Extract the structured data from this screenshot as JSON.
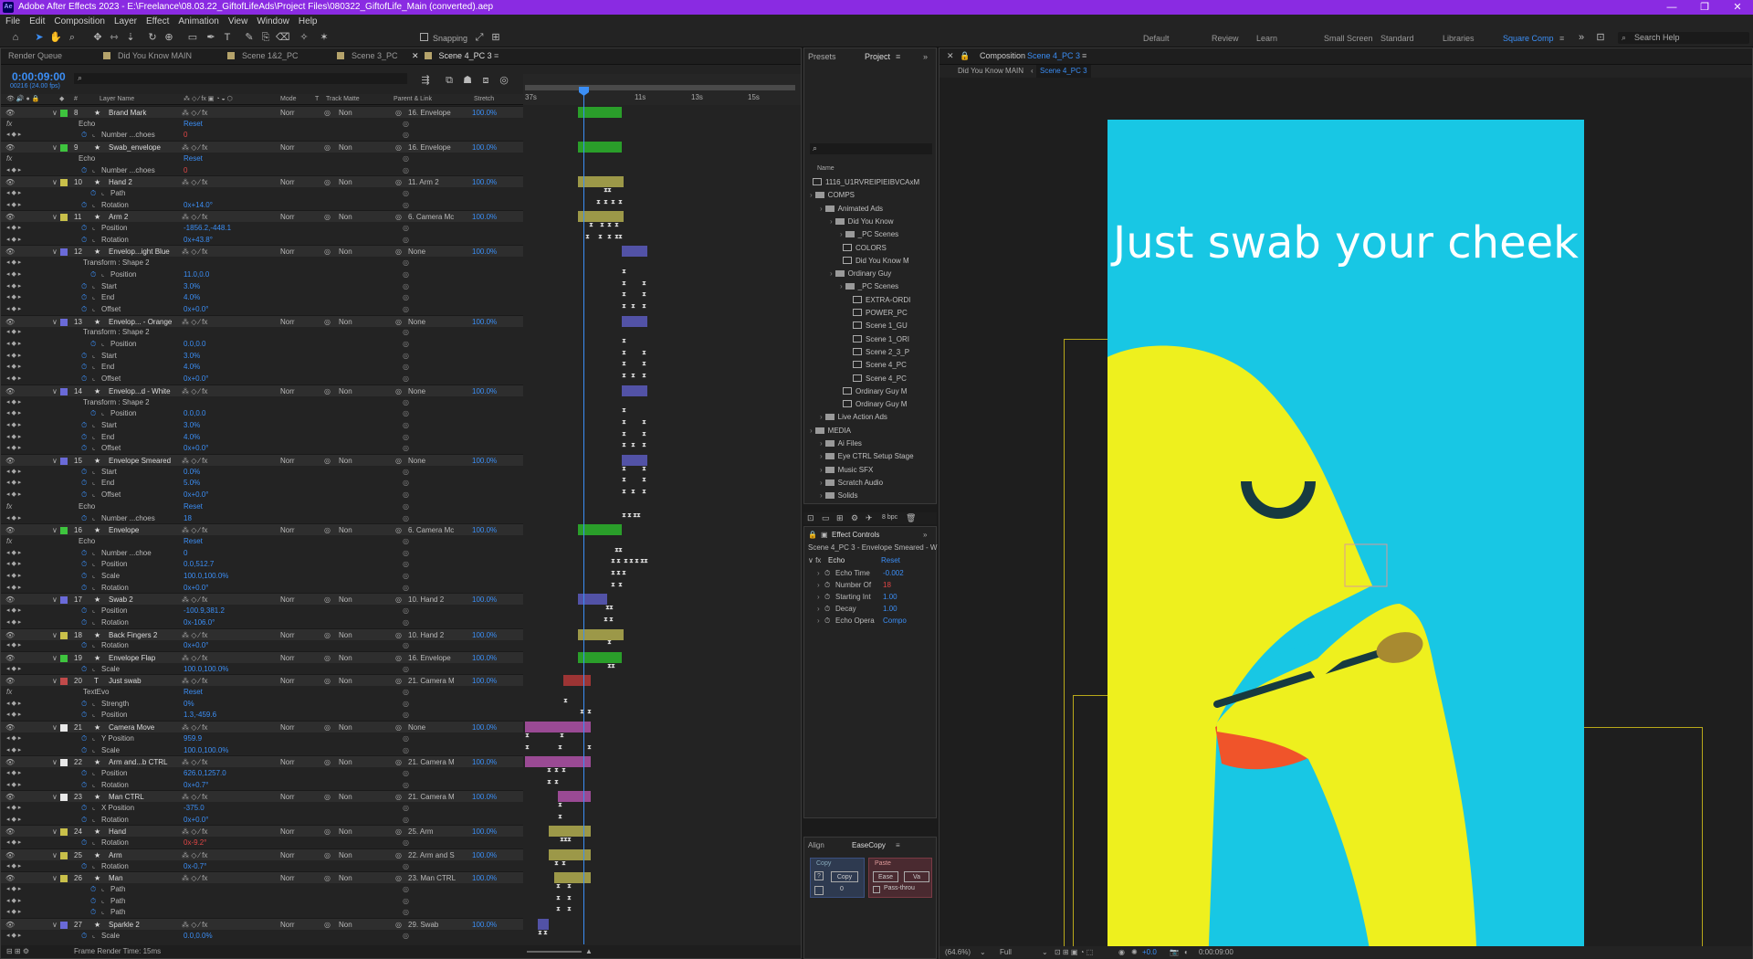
{
  "titlebar": {
    "app_logo": "Ae",
    "title": "Adobe After Effects 2023 - E:\\Freelance\\08.03.22_GiftofLifeAds\\Project Files\\080322_GiftofLife_Main (converted).aep",
    "minimize": "—",
    "maximize": "❐",
    "close": "✕"
  },
  "menu": [
    "File",
    "Edit",
    "Composition",
    "Layer",
    "Effect",
    "Animation",
    "View",
    "Window",
    "Help"
  ],
  "toolbar": {
    "snapping": "Snapping",
    "workspaces": [
      "Default",
      "Review",
      "Learn",
      "Small Screen",
      "Standard",
      "Libraries",
      "Square Comp"
    ],
    "active_workspace": "Square Comp",
    "search_help": "Search Help"
  },
  "timeline": {
    "tabs": [
      "Render Queue",
      "Did You Know MAIN",
      "Scene 1&2_PC",
      "Scene 3_PC",
      "Scene 4_PC 3"
    ],
    "timecode": "0:00:09:00",
    "fps": "00216 (24.00 fps)",
    "columns": [
      "Layer Name",
      "Mode",
      "T",
      "Track Matte",
      "Parent & Link",
      "Stretch"
    ],
    "ruler": [
      "37s",
      "11s",
      "13s",
      "15s"
    ],
    "footer": "Frame Render Time: 15ms",
    "rows": [
      {
        "t": "L",
        "n": "8",
        "name": "Brand Mark",
        "mode": "Norr",
        "mat": "Non",
        "parent": "16. Envelope",
        "str": "100.0%",
        "c": "#3ec43e",
        "bar": [
          60,
          108
        ],
        "bc": "#2a9e2a"
      },
      {
        "t": "P",
        "ind": 85,
        "name": "Echo",
        "val": "Reset"
      },
      {
        "t": "P",
        "ind": 110,
        "name": "Number ...choes",
        "val": "0",
        "red": true
      },
      {
        "t": "L",
        "n": "9",
        "name": "Swab_envelope",
        "mode": "Norr",
        "mat": "Non",
        "parent": "16. Envelope",
        "str": "100.0%",
        "c": "#3ec43e",
        "bar": [
          60,
          108
        ],
        "bc": "#2a9e2a"
      },
      {
        "t": "P",
        "ind": 85,
        "name": "Echo",
        "val": "Reset"
      },
      {
        "t": "P",
        "ind": 110,
        "name": "Number ...choes",
        "val": "0",
        "red": true
      },
      {
        "t": "L",
        "n": "10",
        "name": "Hand 2",
        "mode": "Norr",
        "mat": "Non",
        "parent": "11. Arm 2",
        "str": "100.0%",
        "c": "#c9c04a",
        "bar": [
          60,
          110
        ],
        "bc": "#9c9848"
      },
      {
        "t": "P",
        "ind": 120,
        "name": "Path",
        "val": "",
        "kf": [
          88,
          92
        ]
      },
      {
        "t": "P",
        "ind": 110,
        "name": "Rotation",
        "val": "0x+14.0°",
        "kf": [
          80,
          88,
          96,
          104
        ]
      },
      {
        "t": "L",
        "n": "11",
        "name": "Arm 2",
        "mode": "Norr",
        "mat": "Non",
        "parent": "6. Camera Mc",
        "str": "100.0%",
        "c": "#c9c04a",
        "bar": [
          60,
          110
        ],
        "bc": "#9c9848"
      },
      {
        "t": "P",
        "ind": 110,
        "name": "Position",
        "val": "-1856.2,-448.1",
        "kf": [
          72,
          84,
          92,
          100
        ]
      },
      {
        "t": "P",
        "ind": 110,
        "name": "Rotation",
        "val": "0x+43.8°",
        "kf": [
          68,
          82,
          92,
          100,
          104
        ]
      },
      {
        "t": "L",
        "n": "12",
        "name": "Envelop...ight Blue",
        "mode": "Norr",
        "mat": "Non",
        "parent": "None",
        "str": "100.0%",
        "c": "#6a6ad8",
        "bar": [
          108,
          136
        ],
        "bc": "#5252a6"
      },
      {
        "t": "P",
        "ind": 90,
        "name": "Transform : Shape 2",
        "val": ""
      },
      {
        "t": "P",
        "ind": 120,
        "name": "Position",
        "val": "11.0,0.0",
        "kf": [
          108
        ]
      },
      {
        "t": "P",
        "ind": 110,
        "name": "Start",
        "val": "3.0%",
        "kf": [
          108,
          130
        ]
      },
      {
        "t": "P",
        "ind": 110,
        "name": "End",
        "val": "4.0%",
        "kf": [
          108,
          130
        ]
      },
      {
        "t": "P",
        "ind": 110,
        "name": "Offset",
        "val": "0x+0.0°",
        "kf": [
          108,
          118,
          130
        ]
      },
      {
        "t": "L",
        "n": "13",
        "name": "Envelop... - Orange",
        "mode": "Norr",
        "mat": "Non",
        "parent": "None",
        "str": "100.0%",
        "c": "#6a6ad8",
        "bar": [
          108,
          136
        ],
        "bc": "#5252a6"
      },
      {
        "t": "P",
        "ind": 90,
        "name": "Transform : Shape 2",
        "val": ""
      },
      {
        "t": "P",
        "ind": 120,
        "name": "Position",
        "val": "0.0,0.0",
        "kf": [
          108
        ]
      },
      {
        "t": "P",
        "ind": 110,
        "name": "Start",
        "val": "3.0%",
        "kf": [
          108,
          130
        ]
      },
      {
        "t": "P",
        "ind": 110,
        "name": "End",
        "val": "4.0%",
        "kf": [
          108,
          130
        ]
      },
      {
        "t": "P",
        "ind": 110,
        "name": "Offset",
        "val": "0x+0.0°",
        "kf": [
          108,
          118,
          130
        ]
      },
      {
        "t": "L",
        "n": "14",
        "name": "Envelop...d - White",
        "mode": "Norr",
        "mat": "Non",
        "parent": "None",
        "str": "100.0%",
        "c": "#6a6ad8",
        "bar": [
          108,
          136
        ],
        "bc": "#5252a6"
      },
      {
        "t": "P",
        "ind": 90,
        "name": "Transform : Shape 2",
        "val": ""
      },
      {
        "t": "P",
        "ind": 120,
        "name": "Position",
        "val": "0.0,0.0",
        "kf": [
          108
        ]
      },
      {
        "t": "P",
        "ind": 110,
        "name": "Start",
        "val": "3.0%",
        "kf": [
          108,
          130
        ]
      },
      {
        "t": "P",
        "ind": 110,
        "name": "End",
        "val": "4.0%",
        "kf": [
          108,
          130
        ]
      },
      {
        "t": "P",
        "ind": 110,
        "name": "Offset",
        "val": "0x+0.0°",
        "kf": [
          108,
          118,
          130
        ]
      },
      {
        "t": "L",
        "n": "15",
        "name": "Envelope Smeared",
        "mode": "Norr",
        "mat": "Non",
        "parent": "None",
        "str": "100.0%",
        "c": "#6a6ad8",
        "bar": [
          108,
          136
        ],
        "bc": "#5252a6"
      },
      {
        "t": "P",
        "ind": 110,
        "name": "Start",
        "val": "0.0%",
        "kf": [
          108,
          130
        ]
      },
      {
        "t": "P",
        "ind": 110,
        "name": "End",
        "val": "5.0%",
        "kf": [
          108,
          130
        ]
      },
      {
        "t": "P",
        "ind": 110,
        "name": "Offset",
        "val": "0x+0.0°",
        "kf": [
          108,
          118,
          130
        ]
      },
      {
        "t": "P",
        "ind": 85,
        "name": "Echo",
        "val": "Reset"
      },
      {
        "t": "P",
        "ind": 110,
        "name": "Number ...choes",
        "val": "18",
        "kf": [
          108,
          114,
          120,
          124
        ]
      },
      {
        "t": "L",
        "n": "16",
        "name": "Envelope",
        "mode": "Norr",
        "mat": "Non",
        "parent": "6. Camera Mc",
        "str": "100.0%",
        "c": "#3ec43e",
        "bar": [
          60,
          108
        ],
        "bc": "#2a9e2a"
      },
      {
        "t": "P",
        "ind": 85,
        "name": "Echo",
        "val": "Reset"
      },
      {
        "t": "P",
        "ind": 110,
        "name": "Number ...choe",
        "val": "0",
        "kf": [
          100,
          104
        ]
      },
      {
        "t": "P",
        "ind": 110,
        "name": "Position",
        "val": "0.0,512.7",
        "kf": [
          96,
          102,
          110,
          116,
          122,
          128,
          132
        ]
      },
      {
        "t": "P",
        "ind": 110,
        "name": "Scale",
        "val": "100.0,100.0%",
        "kf": [
          96,
          102,
          108
        ]
      },
      {
        "t": "P",
        "ind": 110,
        "name": "Rotation",
        "val": "0x+0.0°",
        "kf": [
          96,
          104
        ]
      },
      {
        "t": "L",
        "n": "17",
        "name": "Swab 2",
        "mode": "Norr",
        "mat": "Non",
        "parent": "10. Hand 2",
        "str": "100.0%",
        "c": "#6a6ad8",
        "bar": [
          60,
          92
        ],
        "bc": "#5252a6"
      },
      {
        "t": "P",
        "ind": 110,
        "name": "Position",
        "val": "-100.9,381.2",
        "kf": [
          90,
          94
        ]
      },
      {
        "t": "P",
        "ind": 110,
        "name": "Rotation",
        "val": "0x-106.0°",
        "kf": [
          88,
          94
        ]
      },
      {
        "t": "L",
        "n": "18",
        "name": "Back Fingers 2",
        "mode": "Norr",
        "mat": "Non",
        "parent": "10. Hand 2",
        "str": "100.0%",
        "c": "#c9c04a",
        "bar": [
          60,
          110
        ],
        "bc": "#9c9848"
      },
      {
        "t": "P",
        "ind": 110,
        "name": "Rotation",
        "val": "0x+0.0°",
        "kf": [
          92
        ]
      },
      {
        "t": "L",
        "n": "19",
        "name": "Envelope Flap",
        "mode": "Norr",
        "mat": "Non",
        "parent": "16. Envelope",
        "str": "100.0%",
        "c": "#3ec43e",
        "bar": [
          60,
          108
        ],
        "bc": "#2a9e2a"
      },
      {
        "t": "P",
        "ind": 110,
        "name": "Scale",
        "val": "100.0,100.0%",
        "kf": [
          92,
          96
        ]
      },
      {
        "t": "L",
        "n": "20",
        "name": "Just swab",
        "mode": "Norr",
        "mat": "Non",
        "parent": "21. Camera M",
        "str": "100.0%",
        "c": "#c14a4a",
        "bar": [
          44,
          74
        ],
        "bc": "#9c3434",
        "text": true
      },
      {
        "t": "P",
        "ind": 90,
        "name": "TextEvo",
        "val": "Reset"
      },
      {
        "t": "P",
        "ind": 110,
        "name": "Strength",
        "val": "0%",
        "kf": [
          44
        ]
      },
      {
        "t": "P",
        "ind": 110,
        "name": "Position",
        "val": "1.3,-459.6",
        "kf": [
          62,
          70
        ]
      },
      {
        "t": "L",
        "n": "21",
        "name": "Camera Move",
        "mode": "Norr",
        "mat": "Non",
        "parent": "None",
        "str": "100.0%",
        "c": "#e8e8e8",
        "bar": [
          2,
          74
        ],
        "bc": "#9a4a94"
      },
      {
        "t": "P",
        "ind": 110,
        "name": "Y Position",
        "val": "959.9",
        "kf": [
          2,
          40
        ]
      },
      {
        "t": "P",
        "ind": 110,
        "name": "Scale",
        "val": "100.0,100.0%",
        "kf": [
          2,
          38,
          70
        ]
      },
      {
        "t": "L",
        "n": "22",
        "name": "Arm and...b CTRL",
        "mode": "Norr",
        "mat": "Non",
        "parent": "21. Camera M",
        "str": "100.0%",
        "c": "#e8e8e8",
        "bar": [
          2,
          74
        ],
        "bc": "#9a4a94"
      },
      {
        "t": "P",
        "ind": 110,
        "name": "Position",
        "val": "626.0,1257.0",
        "kf": [
          26,
          34,
          42
        ]
      },
      {
        "t": "P",
        "ind": 110,
        "name": "Rotation",
        "val": "0x+0.7°",
        "kf": [
          26,
          34
        ]
      },
      {
        "t": "L",
        "n": "23",
        "name": "Man CTRL",
        "mode": "Norr",
        "mat": "Non",
        "parent": "21. Camera M",
        "str": "100.0%",
        "c": "#e8e8e8",
        "bar": [
          38,
          74
        ],
        "bc": "#9a4a94"
      },
      {
        "t": "P",
        "ind": 110,
        "name": "X Position",
        "val": "-375.0",
        "kf": [
          38
        ]
      },
      {
        "t": "P",
        "ind": 110,
        "name": "Rotation",
        "val": "0x+0.0°",
        "kf": [
          38
        ]
      },
      {
        "t": "L",
        "n": "24",
        "name": "Hand",
        "mode": "Norr",
        "mat": "Non",
        "parent": "25. Arm",
        "str": "100.0%",
        "c": "#c9c04a",
        "bar": [
          28,
          74
        ],
        "bc": "#9c9848"
      },
      {
        "t": "P",
        "ind": 110,
        "name": "Rotation",
        "val": "0x-9.2°",
        "red": true,
        "kf": [
          40,
          44,
          48
        ]
      },
      {
        "t": "L",
        "n": "25",
        "name": "Arm",
        "mode": "Norr",
        "mat": "Non",
        "parent": "22. Arm and S",
        "str": "100.0%",
        "c": "#c9c04a",
        "bar": [
          28,
          74
        ],
        "bc": "#9c9848"
      },
      {
        "t": "P",
        "ind": 110,
        "name": "Rotation",
        "val": "0x-0.7°",
        "kf": [
          34,
          42
        ]
      },
      {
        "t": "L",
        "n": "26",
        "name": "Man",
        "mode": "Norr",
        "mat": "Non",
        "parent": "23. Man CTRL",
        "str": "100.0%",
        "c": "#c9c04a",
        "bar": [
          34,
          74
        ],
        "bc": "#9c9848"
      },
      {
        "t": "P",
        "ind": 120,
        "name": "Path",
        "val": "",
        "kf": [
          36,
          48
        ]
      },
      {
        "t": "P",
        "ind": 120,
        "name": "Path",
        "val": "",
        "kf": [
          36,
          48
        ]
      },
      {
        "t": "P",
        "ind": 120,
        "name": "Path",
        "val": "",
        "kf": [
          36,
          48
        ]
      },
      {
        "t": "L",
        "n": "27",
        "name": "Sparkle 2",
        "mode": "Norr",
        "mat": "Non",
        "parent": "29. Swab",
        "str": "100.0%",
        "c": "#6a6ad8",
        "bar": [
          16,
          28
        ],
        "bc": "#5252a6"
      },
      {
        "t": "P",
        "ind": 110,
        "name": "Scale",
        "val": "0.0,0.0%",
        "kf": [
          16,
          22
        ]
      }
    ]
  },
  "project": {
    "tabs": [
      "Presets",
      "Project"
    ],
    "items": [
      {
        "i": 0,
        "k": "comp",
        "n": "1116_U1RVREIPIEIBVCAxM"
      },
      {
        "i": 0,
        "k": "folder",
        "n": "COMPS"
      },
      {
        "i": 1,
        "k": "folder",
        "n": "Animated Ads"
      },
      {
        "i": 2,
        "k": "folder",
        "n": "Did You Know"
      },
      {
        "i": 3,
        "k": "folder",
        "n": "_PC Scenes"
      },
      {
        "i": 3,
        "k": "comp",
        "n": "COLORS"
      },
      {
        "i": 3,
        "k": "comp",
        "n": "Did You Know M"
      },
      {
        "i": 2,
        "k": "folder",
        "n": "Ordinary Guy"
      },
      {
        "i": 3,
        "k": "folder",
        "n": "_PC Scenes"
      },
      {
        "i": 4,
        "k": "comp",
        "n": "EXTRA-ORDI"
      },
      {
        "i": 4,
        "k": "comp",
        "n": "POWER_PC"
      },
      {
        "i": 4,
        "k": "comp",
        "n": "Scene 1_GU"
      },
      {
        "i": 4,
        "k": "comp",
        "n": "Scene 1_ORI"
      },
      {
        "i": 4,
        "k": "comp",
        "n": "Scene 2_3_P"
      },
      {
        "i": 4,
        "k": "comp",
        "n": "Scene 4_PC"
      },
      {
        "i": 4,
        "k": "comp",
        "n": "Scene 4_PC"
      },
      {
        "i": 3,
        "k": "comp",
        "n": "Ordinary Guy M"
      },
      {
        "i": 3,
        "k": "comp",
        "n": "Ordinary Guy M"
      },
      {
        "i": 1,
        "k": "folder",
        "n": "Live Action Ads"
      },
      {
        "i": 0,
        "k": "folder",
        "n": "MEDIA"
      },
      {
        "i": 1,
        "k": "folder",
        "n": "Ai Files"
      },
      {
        "i": 1,
        "k": "folder",
        "n": "Eye CTRL Setup Stage"
      },
      {
        "i": 1,
        "k": "folder",
        "n": "Music SFX"
      },
      {
        "i": 1,
        "k": "folder",
        "n": "Scratch Audio"
      },
      {
        "i": 1,
        "k": "folder",
        "n": "Solids"
      }
    ],
    "name_col": "Name",
    "bpc": "8 bpc"
  },
  "effect_controls": {
    "tab": "Effect Controls",
    "layer": "Scene 4_PC 3 - Envelope Smeared - W",
    "effect": "Echo",
    "reset": "Reset",
    "props": [
      {
        "n": "Echo Time",
        "v": "-0.002"
      },
      {
        "n": "Number Of",
        "v": "18",
        "red": true
      },
      {
        "n": "Starting Int",
        "v": "1.00"
      },
      {
        "n": "Decay",
        "v": "1.00"
      },
      {
        "n": "Echo Opera",
        "v": "Compo"
      }
    ]
  },
  "easecopy": {
    "tabs": [
      "Align",
      "EaseCopy"
    ],
    "copy_title": "Copy",
    "copy_btn": "Copy",
    "copy_val": "0",
    "paste_title": "Paste",
    "ease_btn": "Ease",
    "val_btn": "Va",
    "pass_through": "Pass-throu"
  },
  "composition": {
    "tab_prefix": "Composition",
    "tab_name": "Scene 4_PC 3",
    "breadcrumb": [
      "Did You Know MAIN",
      "Scene 4_PC 3"
    ],
    "text": "Just swab your cheek",
    "zoom": "(64.6%)",
    "quality": "Full",
    "time": "0:00:09:00",
    "exposure": "+0.0"
  },
  "colors": {
    "accent": "#3b8ef5",
    "artboard": "#18c7e4",
    "figure": "#eef01e",
    "mouth": "#f0542a",
    "dark": "#173a40",
    "title_bar": "#8a2be2"
  }
}
